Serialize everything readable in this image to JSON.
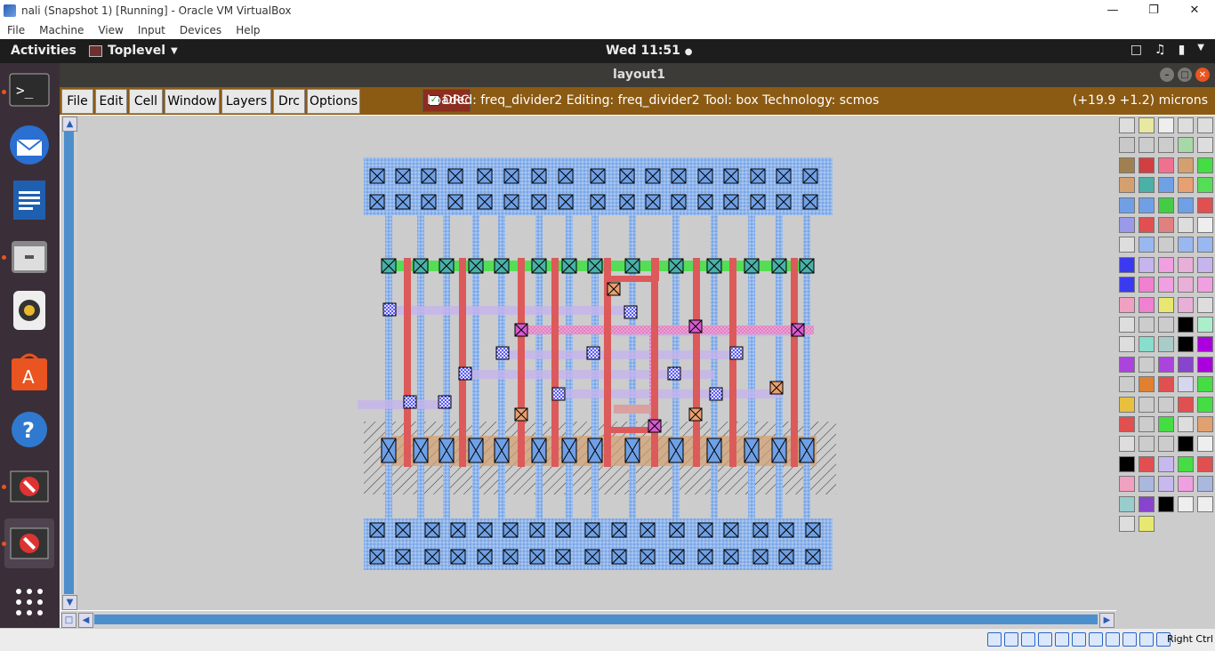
{
  "vbox": {
    "title": "nali (Snapshot 1) [Running] - Oracle VM VirtualBox",
    "menu": [
      "File",
      "Machine",
      "View",
      "Input",
      "Devices",
      "Help"
    ],
    "host_key": "Right Ctrl"
  },
  "gnome": {
    "activities": "Activities",
    "app_menu": "Toplevel",
    "clock": "Wed 11:51"
  },
  "magic": {
    "window_title": "layout1",
    "menu": [
      "File",
      "Edit",
      "Cell",
      "Window",
      "Layers",
      "Drc",
      "Options"
    ],
    "drc_label": "DRC",
    "status": "Loaded: freq_divider2 Editing: freq_divider2 Tool: box  Technology: scmos",
    "coords": "(+19.9 +1.2) microns"
  },
  "dock": {
    "items": [
      "terminal-icon",
      "thunderbird-icon",
      "writer-icon",
      "files-icon",
      "rhythmbox-icon",
      "software-center-icon",
      "help-icon",
      "app-blocked-icon",
      "app-blocked-active-icon",
      "show-apps-icon"
    ]
  },
  "layout_colors": {
    "metal1": "#8fb4ec",
    "metal2": "#dc5a5a",
    "poly": "#e58fc5",
    "ndiff": "#55dd55",
    "contact_fill": "#6fa0e6",
    "via_fill": "#3333ee",
    "well_hatch": "#333333",
    "canvas_bg": "#cccccc"
  }
}
